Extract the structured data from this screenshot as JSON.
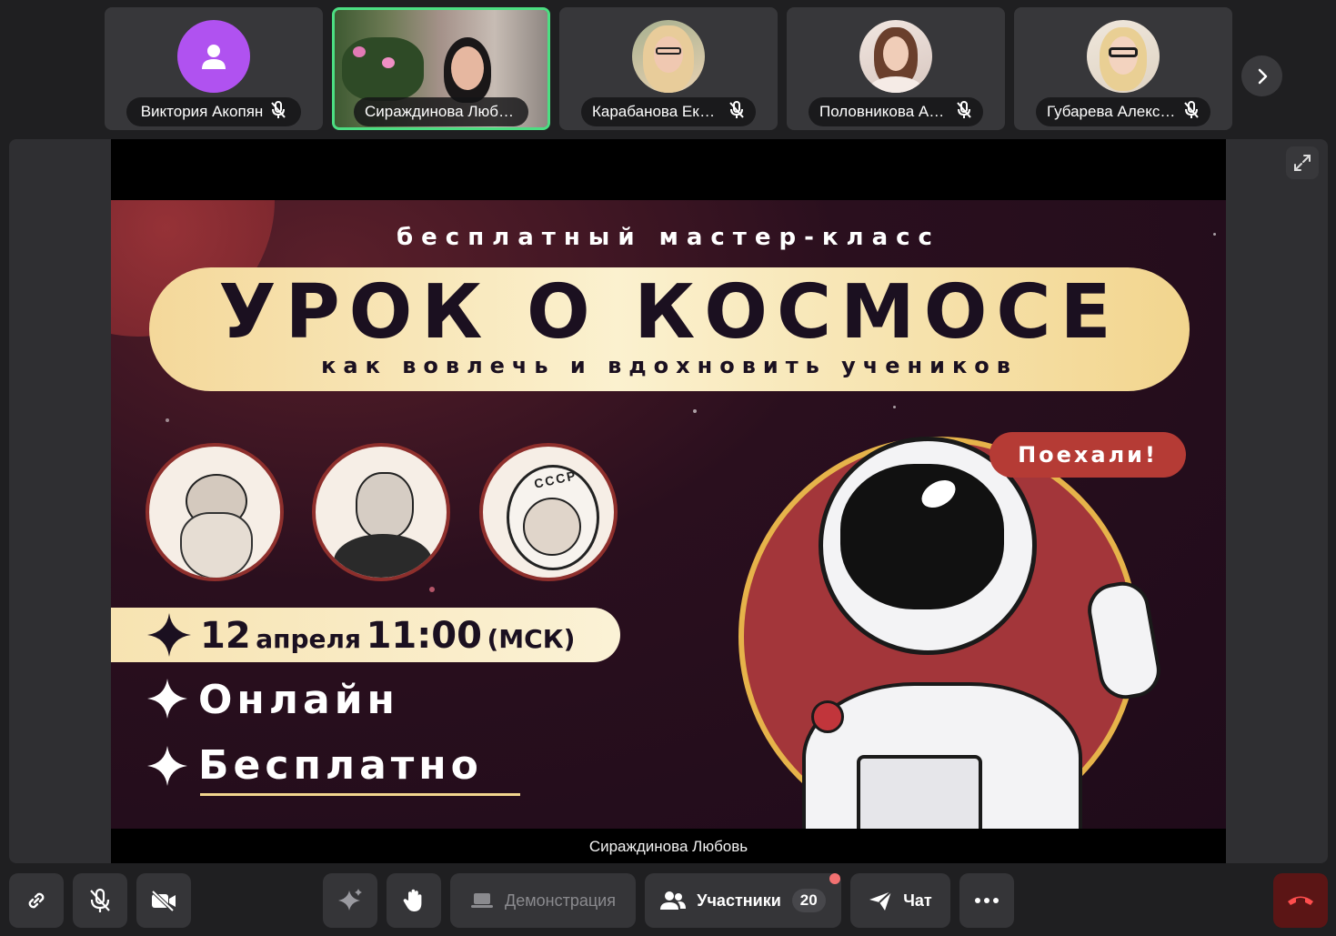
{
  "participants": [
    {
      "name": "Виктория Акопян",
      "avatar": "user-placeholder-icon"
    },
    {
      "name": "Сираждинова Любовь",
      "active": true
    },
    {
      "name": "Карабанова Екате..."
    },
    {
      "name": "Половникова Анас..."
    },
    {
      "name": "Губарева Алексан..."
    }
  ],
  "stage": {
    "presenter_label": "Сираждинова Любовь",
    "slide": {
      "subtitle": "бесплатный мастер-класс",
      "title": "УРОК О КОСМОСЕ",
      "tagline": "как вовлечь и вдохновить учеников",
      "speech_bubble": "Поехали!",
      "date_day": "12",
      "date_month": "апреля",
      "date_time": "11:00",
      "date_tz": "(МСК)",
      "feature_1": "Онлайн",
      "feature_2": "Бесплатно",
      "helmet_text": "СССР"
    }
  },
  "controls": {
    "demo_label": "Демонстрация",
    "participants_label": "Участники",
    "participants_count": "20",
    "chat_label": "Чат"
  },
  "colors": {
    "active_border": "#4cde82",
    "end_call": "#5b1515",
    "notification_dot": "#f27171"
  }
}
